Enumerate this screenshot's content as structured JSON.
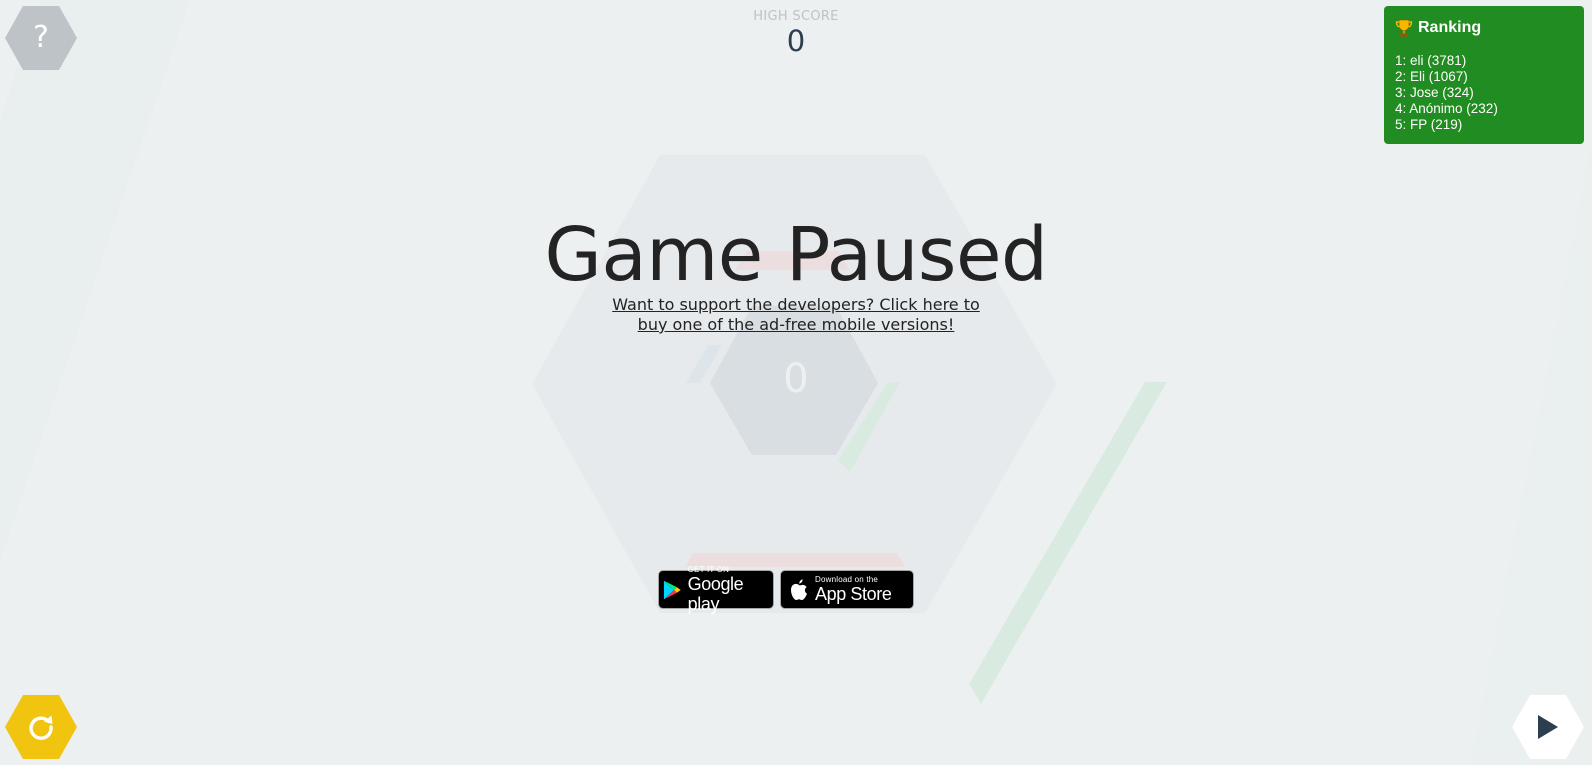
{
  "high_score": {
    "label": "HIGH SCORE",
    "value": "0"
  },
  "help_button": {
    "label": "?",
    "icon": "question-mark-icon"
  },
  "ranking": {
    "title": "Ranking",
    "icon": "trophy-icon",
    "entries": [
      "1: eli (3781)",
      "2: Eli (1067)",
      "3: Jose (324)",
      "4: Anónimo (232)",
      "5: FP (219)"
    ]
  },
  "pause": {
    "title": "Game Paused",
    "support_line1": "Want to support the developers? Click here to",
    "support_line2": "buy one of the ad-free mobile versions!"
  },
  "center": {
    "score": "0"
  },
  "badges": {
    "google": {
      "small": "GET IT ON",
      "large": "Google play",
      "icon": "google-play-icon"
    },
    "apple": {
      "small": "Download on the",
      "large": "App Store",
      "icon": "apple-icon"
    }
  },
  "controls": {
    "restart_icon": "restart-icon",
    "play_icon": "play-icon"
  },
  "colors": {
    "background": "#ecf0f1",
    "ranking_panel": "#218c21",
    "restart_button": "#f1c40f",
    "help_button": "#bdc3c7",
    "play_button": "#ffffff",
    "title_text": "#232323",
    "score_text": "#2c3e50",
    "block_red": "#e74c3c",
    "block_green": "#2ecc71",
    "block_blue": "#3498db"
  }
}
